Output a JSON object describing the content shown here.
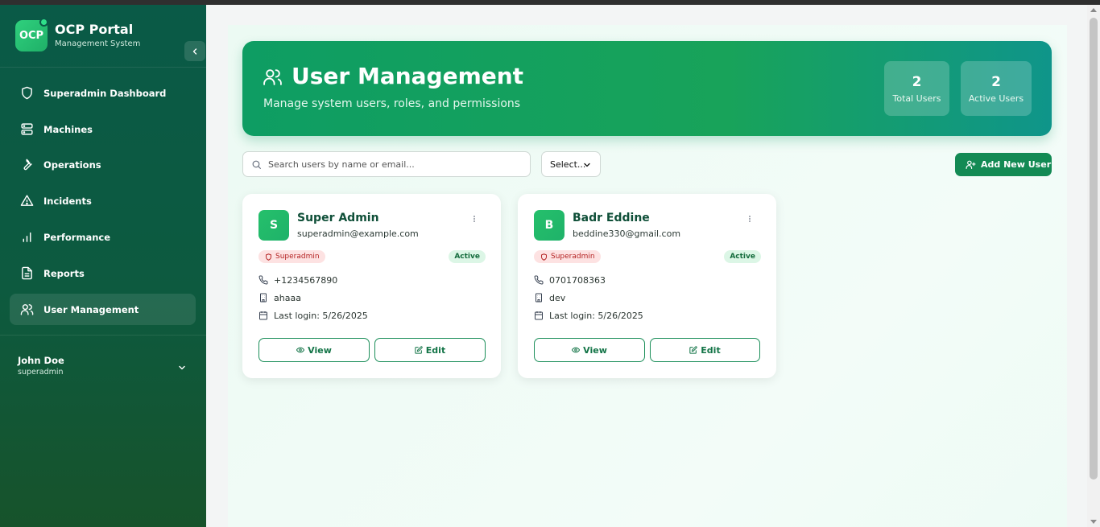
{
  "brand": {
    "logo_text": "OCP",
    "title": "OCP Portal",
    "subtitle": "Management System"
  },
  "sidebar": {
    "items": [
      {
        "label": "Superadmin Dashboard",
        "icon": "shield-icon",
        "active": false
      },
      {
        "label": "Machines",
        "icon": "server-icon",
        "active": false
      },
      {
        "label": "Operations",
        "icon": "wrench-icon",
        "active": false
      },
      {
        "label": "Incidents",
        "icon": "alert-triangle-icon",
        "active": false
      },
      {
        "label": "Performance",
        "icon": "bar-chart-icon",
        "active": false
      },
      {
        "label": "Reports",
        "icon": "file-text-icon",
        "active": false
      },
      {
        "label": "User Management",
        "icon": "users-icon",
        "active": true
      }
    ],
    "user": {
      "name": "John Doe",
      "role": "superadmin"
    }
  },
  "header": {
    "title": "User Management",
    "subtitle": "Manage system users, roles, and permissions",
    "stats": [
      {
        "value": "2",
        "label": "Total Users"
      },
      {
        "value": "2",
        "label": "Active Users"
      }
    ]
  },
  "toolbar": {
    "search_placeholder": "Search users by name or email...",
    "select_value": "Select...",
    "add_label": "Add New User"
  },
  "users": [
    {
      "initial": "S",
      "name": "Super Admin",
      "email": "superadmin@example.com",
      "role": "Superadmin",
      "status": "Active",
      "phone": "+1234567890",
      "department": "ahaaa",
      "last_login": "Last login: 5/26/2025",
      "view_label": "View",
      "edit_label": "Edit"
    },
    {
      "initial": "B",
      "name": "Badr Eddine",
      "email": "beddine330@gmail.com",
      "role": "Superadmin",
      "status": "Active",
      "phone": "0701708363",
      "department": "dev",
      "last_login": "Last login: 5/26/2025",
      "view_label": "View",
      "edit_label": "Edit"
    }
  ],
  "colors": {
    "sidebar": "#0a5a47",
    "accent": "#138a54",
    "banner_start": "#0e9d63",
    "banner_end": "#0f958a",
    "role_badge": "#fde2e2",
    "status_badge": "#dcf6e6"
  }
}
